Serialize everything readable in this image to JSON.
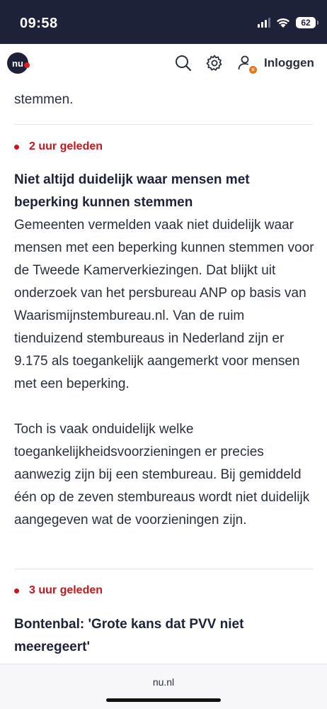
{
  "status_bar": {
    "time": "09:58",
    "battery": "62",
    "icons": [
      "signal-icon",
      "wifi-icon",
      "battery-icon"
    ]
  },
  "header": {
    "logo_text": "nu",
    "login_label": "Inloggen",
    "icons": [
      "search-icon",
      "gear-icon",
      "user-icon"
    ],
    "accent_color": "#c8161d",
    "brand_color": "#1d2238"
  },
  "feed": {
    "cutoff_text": "stemmen.",
    "items": [
      {
        "time": "2 uur geleden",
        "headline": "Niet altijd duidelijk waar mensen met beperking kunnen stemmen",
        "paragraph1": "Gemeenten vermelden vaak niet duidelijk waar mensen met een beperking kunnen stemmen voor de Tweede Kamerverkiezingen. Dat blijkt uit onderzoek van het persbureau ANP op basis van Waarismijnstembureau.nl. Van de ruim tienduizend stembureaus in Nederland zijn er 9.175 als toegankelijk aangemerkt voor mensen met een beperking.",
        "paragraph2": "Toch is vaak onduidelijk welke toegankelijkheidsvoorzieningen er precies aanwezig zijn bij een stembureau. Bij gemiddeld één op de zeven stembureaus wordt niet duidelijk aangegeven wat de voorzieningen zijn."
      },
      {
        "time": "3 uur geleden",
        "headline": "Bontenbal: 'Grote kans dat PVV niet meeregeert'"
      }
    ]
  },
  "browser": {
    "url": "nu.nl"
  }
}
